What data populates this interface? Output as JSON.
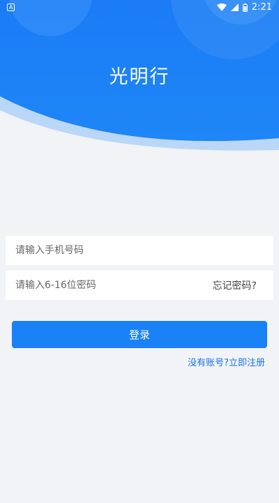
{
  "status_bar": {
    "notification_icon": "a-notification-icon",
    "icons": [
      "wifi-icon",
      "signal-icon",
      "battery-icon"
    ],
    "time": "2:21"
  },
  "header": {
    "title": "光明行"
  },
  "login_form": {
    "phone_placeholder": "请输入手机号码",
    "phone_value": "",
    "password_placeholder": "请输入6-16位密码",
    "password_value": "",
    "forgot_password_label": "忘记密码?",
    "login_label": "登录",
    "register_label": "没有账号?立即注册"
  },
  "colors": {
    "header_blue": "#1a81f6",
    "background": "#f1f3f6",
    "link_blue": "#1a73e8"
  }
}
